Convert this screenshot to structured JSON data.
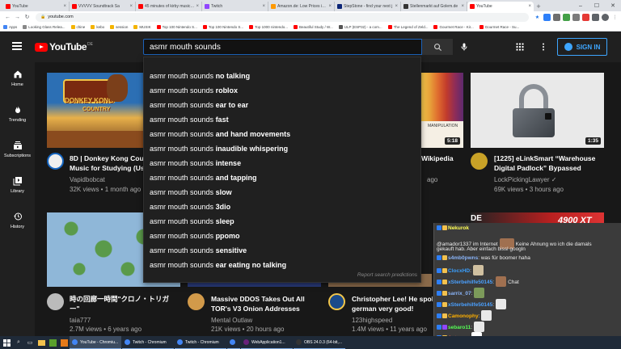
{
  "browser": {
    "tabs": [
      {
        "title": "YouTube",
        "color": "#ff0000"
      },
      {
        "title": "VVVVV Soundtrack Sa",
        "color": "#ff0000"
      },
      {
        "title": "45 minutes of kirby music to",
        "color": "#ff0000"
      },
      {
        "title": "Twitch",
        "color": "#9146ff"
      },
      {
        "title": "Amazon.de: Low Prices in E",
        "color": "#ff9900"
      },
      {
        "title": "StepStone - find your next j",
        "color": "#0c2577"
      },
      {
        "title": "Stellenmarkt auf Golem.de",
        "color": "#333333"
      },
      {
        "title": "YouTube",
        "color": "#ff0000"
      }
    ],
    "url": "youtube.com",
    "bookmarks": [
      {
        "label": "Apps",
        "color": "#4285f4"
      },
      {
        "label": "Looking Glass Relea...",
        "color": "#888888"
      },
      {
        "label": "chine",
        "color": "#f4b400"
      },
      {
        "label": "kebo",
        "color": "#f4b400"
      },
      {
        "label": "session",
        "color": "#f4b400"
      },
      {
        "label": "MUSIK",
        "color": "#f4b400"
      },
      {
        "label": "Top 100 Nintendo S...",
        "color": "#ff0000"
      },
      {
        "label": "Top 100 Nintendo S...",
        "color": "#ff0000"
      },
      {
        "label": "Top 1000 nintendo...",
        "color": "#ff0000"
      },
      {
        "label": "Beautiful Study / W...",
        "color": "#ff0000"
      },
      {
        "label": "ULP (ESP32) - a com...",
        "color": "#555555"
      },
      {
        "label": "The Legend of Zeld...",
        "color": "#ff0000"
      },
      {
        "label": "Gourmet Race - Kir...",
        "color": "#ff0000"
      },
      {
        "label": "Gourmet Race - Su...",
        "color": "#ff0000"
      }
    ]
  },
  "youtube": {
    "logo_text": "YouTube",
    "logo_region": "DE",
    "search_value": "asmr mouth sounds",
    "signin_label": "SIGN IN",
    "sidebar": [
      {
        "label": "Home",
        "icon": "home-icon"
      },
      {
        "label": "Trending",
        "icon": "fire-icon"
      },
      {
        "label": "Subscriptions",
        "icon": "subscriptions-icon"
      },
      {
        "label": "Library",
        "icon": "library-icon"
      },
      {
        "label": "History",
        "icon": "history-icon"
      }
    ],
    "suggestions": [
      {
        "query": "asmr mouth sounds",
        "suffix": "no talking"
      },
      {
        "query": "asmr mouth sounds",
        "suffix": "roblox"
      },
      {
        "query": "asmr mouth sounds",
        "suffix": "ear to ear"
      },
      {
        "query": "asmr mouth sounds",
        "suffix": "fast"
      },
      {
        "query": "asmr mouth sounds",
        "suffix": "and hand movements"
      },
      {
        "query": "asmr mouth sounds",
        "suffix": "inaudible whispering"
      },
      {
        "query": "asmr mouth sounds",
        "suffix": "intense"
      },
      {
        "query": "asmr mouth sounds",
        "suffix": "and tapping"
      },
      {
        "query": "asmr mouth sounds",
        "suffix": "slow"
      },
      {
        "query": "asmr mouth sounds",
        "suffix": "3dio"
      },
      {
        "query": "asmr mouth sounds",
        "suffix": "sleep"
      },
      {
        "query": "asmr mouth sounds",
        "suffix": "ppomo"
      },
      {
        "query": "asmr mouth sounds",
        "suffix": "sensitive"
      },
      {
        "query": "asmr mouth sounds",
        "suffix": "ear eating no talking"
      }
    ],
    "report_label": "Report search predictions",
    "videos": [
      {
        "title1": "8D | Donkey Kong Count",
        "title2": "Music for Studying (Use",
        "channel": "Vapidbobcat",
        "meta": "32K views • 1 month ago",
        "duration": ""
      },
      {
        "title1": "Wikipedia",
        "title2": "",
        "channel": "",
        "meta": "ago",
        "duration": "5:18"
      },
      {
        "title1": "[1225] eLinkSmart “Warehouse",
        "title2": "Digital Padlock” Bypassed",
        "channel": "LockPickingLawyer ✓",
        "meta": "69K views • 3 hours ago",
        "duration": "1:35"
      },
      {
        "title1": "時の回廊一時間\"クロノ・トリガ",
        "title2": "ー\"",
        "channel": "taia777",
        "meta": "2.7M views • 6 years ago",
        "duration": ""
      },
      {
        "title1": "Massive DDOS Takes Out All",
        "title2": "TOR's V3 Onion Addresses",
        "channel": "Mental Outlaw",
        "meta": "21K views • 20 hours ago",
        "duration": ""
      },
      {
        "title1": "Christopher Lee! He spoke",
        "title2": "german very good!",
        "channel": "123highspeed",
        "meta": "1.4M views • 11 years ago",
        "duration": ""
      }
    ],
    "thumb_text_manipulation": "MANIPULATION",
    "thumb_text_de": "DE",
    "thumb_text_4900": "4900 XT",
    "thumb_text_dk": "DONKEY KONG",
    "thumb_text_dk2": "COUNTRY"
  },
  "chat": [
    {
      "user": "Nekurok",
      "user_color": "#ffff55",
      "text": ""
    },
    {
      "user": "",
      "user_color": "#ffffff",
      "text": "@amador1337 im Internet",
      "text2": "Keine Ahnung wo ich die damals"
    },
    {
      "user": "",
      "user_color": "#ffffff",
      "text": "gekauft hab. Aber einfach bissl googln",
      "text2": ""
    },
    {
      "user": "s4mb0pwns",
      "user_color": "#8ab4f8",
      "text": ": was für boomer haha"
    },
    {
      "user": "ClocxHD",
      "user_color": "#3aa0ff",
      "text": ":"
    },
    {
      "user": "xSterbehilfe50145",
      "user_color": "#4aa0ff",
      "text": ":",
      "text2": "Chat"
    },
    {
      "user": "sarrix_07",
      "user_color": "#8ab4f8",
      "text": ":"
    },
    {
      "user": "xSterbehilfe50145",
      "user_color": "#4aa0ff",
      "text": ":"
    },
    {
      "user": "Camonophy",
      "user_color": "#ffb000",
      "text": ":"
    },
    {
      "user": "sebaro11",
      "user_color": "#55ff55",
      "text": ":"
    },
    {
      "user": "Anteyyy",
      "user_color": "#ff5555",
      "text": ":"
    }
  ],
  "taskbar": {
    "apps": [
      {
        "label": "YouTube - Chromiu...",
        "color": "#4285f4",
        "active": true
      },
      {
        "label": "Twitch - Chromium",
        "color": "#4285f4",
        "active": false
      },
      {
        "label": "Twitch - Chromium",
        "color": "#4285f4",
        "active": false
      },
      {
        "label": "",
        "color": "#4285f4",
        "active": false
      },
      {
        "label": "WebApplication1...",
        "color": "#68217a",
        "active": false
      },
      {
        "label": "OBS 24.0.3 (64-bit,...",
        "color": "#333333",
        "active": false
      }
    ]
  }
}
